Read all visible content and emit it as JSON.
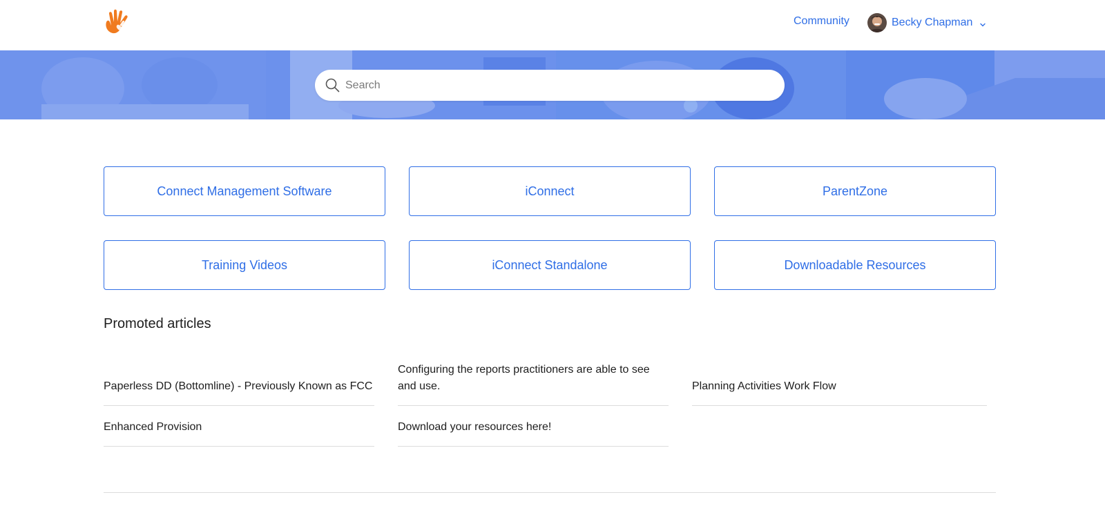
{
  "header": {
    "community_label": "Community",
    "user_name": "Becky Chapman"
  },
  "search": {
    "placeholder": "Search"
  },
  "categories": [
    {
      "label": "Connect Management Software"
    },
    {
      "label": "iConnect"
    },
    {
      "label": "ParentZone"
    },
    {
      "label": "Training Videos"
    },
    {
      "label": "iConnect Standalone"
    },
    {
      "label": "Downloadable Resources"
    }
  ],
  "promoted": {
    "title": "Promoted articles",
    "articles": [
      {
        "title": "Paperless DD (Bottomline) - Previously Known as FCC"
      },
      {
        "title": "Configuring the reports practitioners are able to see and use."
      },
      {
        "title": "Planning Activities Work Flow"
      },
      {
        "title": "Enhanced Provision"
      },
      {
        "title": "Download your resources here!"
      }
    ]
  },
  "colors": {
    "accent": "#2f6ee6",
    "hero_overlay": "#5c87ea",
    "logo_orange": "#f07b1f"
  },
  "icons": {
    "logo": "hand-logo-icon",
    "search": "search-icon",
    "dropdown": "chevron-down-icon"
  }
}
